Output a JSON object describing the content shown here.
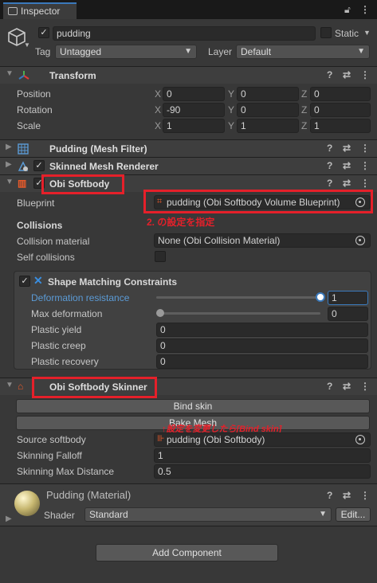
{
  "window": {
    "tab": "Inspector",
    "lock_icon": "lock-icon",
    "menu_icon": "kebab-icon"
  },
  "object": {
    "name": "pudding",
    "static_label": "Static",
    "tag_label": "Tag",
    "tag_value": "Untagged",
    "layer_label": "Layer",
    "layer_value": "Default"
  },
  "transform": {
    "title": "Transform",
    "rows": [
      {
        "label": "Position",
        "x": "0",
        "y": "0",
        "z": "0"
      },
      {
        "label": "Rotation",
        "x": "-90",
        "y": "0",
        "z": "0"
      },
      {
        "label": "Scale",
        "x": "1",
        "y": "1",
        "z": "1"
      }
    ],
    "axes": [
      "X",
      "Y",
      "Z"
    ]
  },
  "mesh_filter": {
    "title": "Pudding (Mesh Filter)"
  },
  "skinned_renderer": {
    "title": "Skinned Mesh Renderer"
  },
  "softbody": {
    "title": "Obi Softbody",
    "blueprint_label": "Blueprint",
    "blueprint_value": "pudding (Obi Softbody Volume Blueprint)",
    "annotation": "2. の設定を指定",
    "collisions_heading": "Collisions",
    "collision_material_label": "Collision material",
    "collision_material_value": "None (Obi Collision Material)",
    "self_collisions_label": "Self collisions"
  },
  "shape_matching": {
    "title": "Shape Matching Constraints",
    "deformation_resistance_label": "Deformation resistance",
    "deformation_resistance_value": "1",
    "deformation_resistance_fraction": 1.0,
    "max_deformation_label": "Max deformation",
    "max_deformation_value": "0",
    "max_deformation_fraction": 0.0,
    "plastic_yield_label": "Plastic yield",
    "plastic_yield_value": "0",
    "plastic_creep_label": "Plastic creep",
    "plastic_creep_value": "0",
    "plastic_recovery_label": "Plastic recovery",
    "plastic_recovery_value": "0"
  },
  "skinner": {
    "title": "Obi Softbody Skinner",
    "bind_skin": "Bind skin",
    "bake_mesh": "Bake Mesh",
    "annotation": "↑設定を変更したら[Bind skin]",
    "source_label": "Source softbody",
    "source_value": "pudding (Obi Softbody)",
    "falloff_label": "Skinning Falloff",
    "falloff_value": "1",
    "max_distance_label": "Skinning Max Distance",
    "max_distance_value": "0.5"
  },
  "material": {
    "title": "Pudding (Material)",
    "shader_label": "Shader",
    "shader_value": "Standard",
    "edit_label": "Edit..."
  },
  "add_component": "Add Component",
  "colors": {
    "accent": "#3a79bb",
    "annotation": "#e5202a",
    "link": "#5b9bd6"
  }
}
